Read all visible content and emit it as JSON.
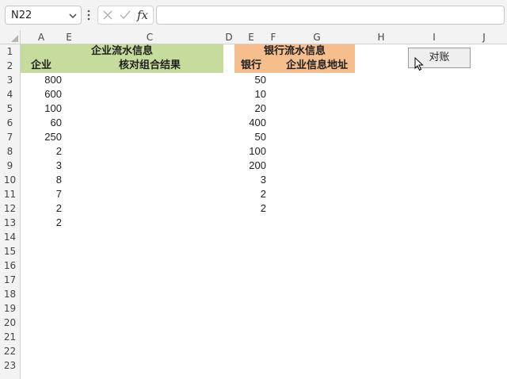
{
  "formula_bar": {
    "name_box": "N22",
    "fx_label": "fx",
    "formula_value": ""
  },
  "columns": [
    "A",
    "E",
    "C",
    "D",
    "E",
    "F",
    "G",
    "H",
    "I",
    "J"
  ],
  "rows": [
    "1",
    "2",
    "3",
    "4",
    "5",
    "6",
    "7",
    "8",
    "9",
    "10",
    "11",
    "12",
    "13",
    "14",
    "15",
    "16",
    "17",
    "18",
    "19",
    "20",
    "21",
    "22",
    "23"
  ],
  "enterprise": {
    "title": "企业流水信息",
    "col1_header": "企业",
    "col2_header": "核对组合结果",
    "values": [
      "800",
      "600",
      "100",
      "60",
      "250",
      "2",
      "3",
      "8",
      "7",
      "2",
      "2"
    ]
  },
  "bank": {
    "title": "银行流水信息",
    "col1_header": "银行",
    "col2_header": "企业信息地址",
    "values": [
      "50",
      "10",
      "20",
      "400",
      "50",
      "100",
      "200",
      "3",
      "2",
      "2"
    ]
  },
  "reconcile_button": {
    "label": "对账"
  },
  "colors": {
    "enterprise_header": "#c5dc9c",
    "bank_header": "#f6bd8d"
  }
}
